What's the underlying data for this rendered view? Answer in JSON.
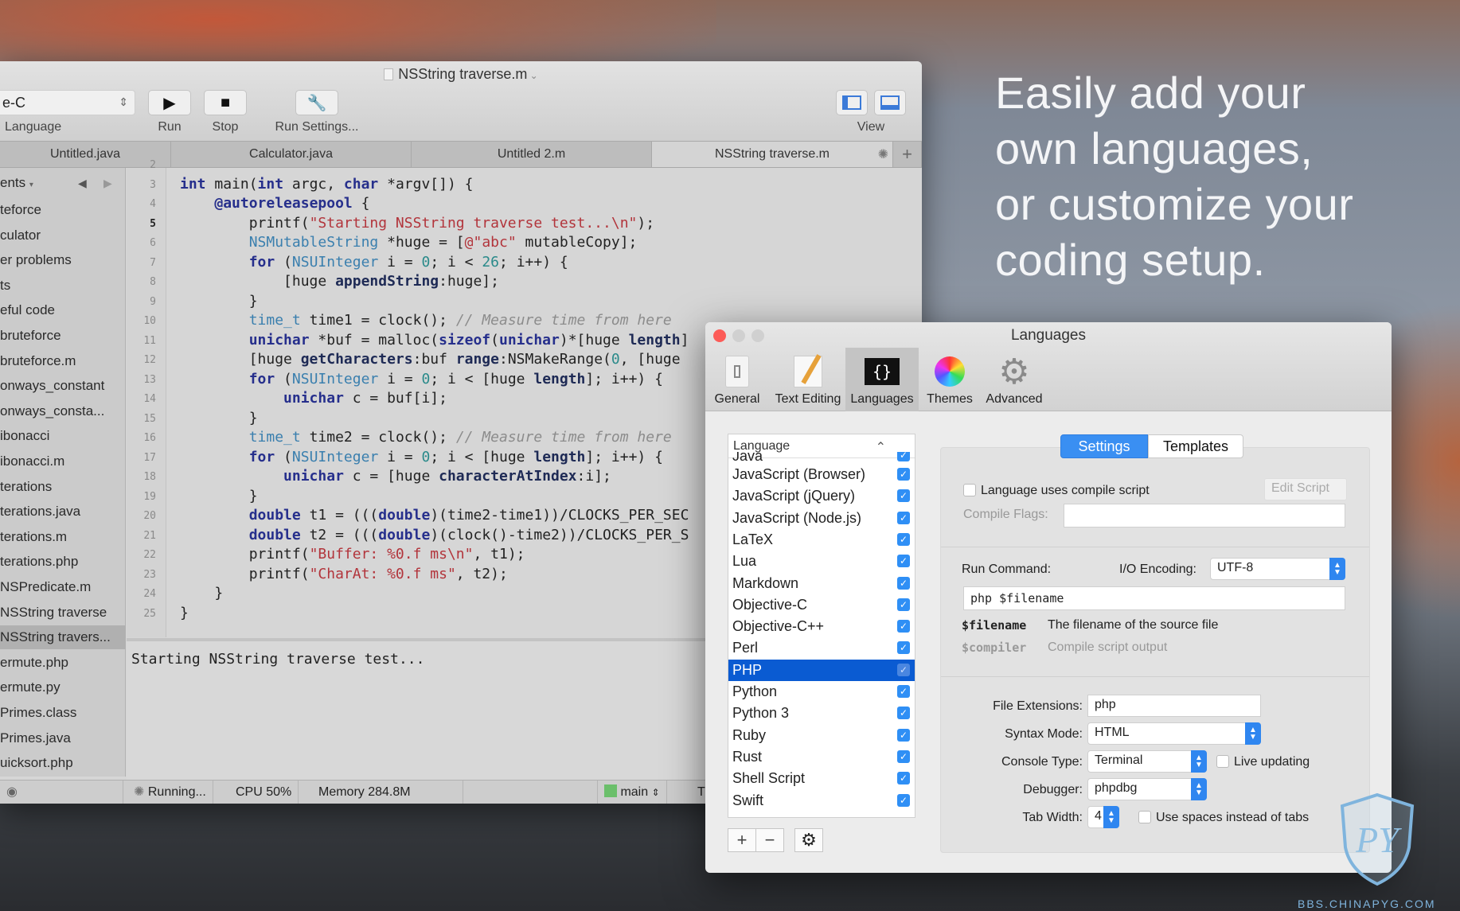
{
  "headline": [
    "Easily add your",
    "own languages,",
    "or customize your",
    "coding setup."
  ],
  "main_window": {
    "title": "NSString traverse.m",
    "toolbar": {
      "language_value": "e-C",
      "language_label": "Language",
      "run_label": "Run",
      "stop_label": "Stop",
      "run_settings_label": "Run Settings...",
      "view_label": "View"
    },
    "tabs": [
      "Untitled.java",
      "Calculator.java",
      "Untitled 2.m",
      "NSString traverse.m"
    ],
    "active_tab": 3,
    "sidebar": {
      "header": "ents",
      "items": [
        "teforce",
        "culator",
        "er problems",
        "ts",
        "eful code",
        "bruteforce",
        "bruteforce.m",
        "onways_constant",
        "onways_consta...",
        "ibonacci",
        "ibonacci.m",
        "terations",
        "terations.java",
        "terations.m",
        "terations.php",
        "NSPredicate.m",
        "NSString traverse",
        "NSString travers...",
        "ermute.php",
        "ermute.py",
        "Primes.class",
        "Primes.java",
        "uicksort.php"
      ],
      "selected": 17
    },
    "current_line": 5,
    "code_lines": [
      {
        "n": "2",
        "t": []
      },
      {
        "n": "3",
        "t": [
          [
            "int",
            "kw"
          ],
          [
            " main("
          ],
          [
            "int",
            "kw"
          ],
          [
            " argc, "
          ],
          [
            "char",
            "kw"
          ],
          [
            " *argv[]) {"
          ]
        ]
      },
      {
        "n": "4",
        "t": [
          [
            "    "
          ],
          [
            "@autoreleasepool",
            "kw"
          ],
          [
            " {"
          ]
        ]
      },
      {
        "n": "5",
        "t": [
          [
            "        printf("
          ],
          [
            "\"Starting NSString traverse test...\\n\"",
            "str"
          ],
          [
            ");"
          ]
        ]
      },
      {
        "n": "6",
        "t": [
          [
            "        "
          ],
          [
            "NSMutableString",
            "ty"
          ],
          [
            " *huge = ["
          ],
          [
            "@\"abc\"",
            "str"
          ],
          [
            " mutableCopy];"
          ]
        ]
      },
      {
        "n": "7",
        "t": [
          [
            "        "
          ],
          [
            "for",
            "kw"
          ],
          [
            " ("
          ],
          [
            "NSUInteger",
            "ty"
          ],
          [
            " i = "
          ],
          [
            "0",
            "num"
          ],
          [
            "; i < "
          ],
          [
            "26",
            "num"
          ],
          [
            "; i++) {"
          ]
        ]
      },
      {
        "n": "8",
        "t": [
          [
            "            [huge "
          ],
          [
            "appendString",
            "mth"
          ],
          [
            ":huge];"
          ]
        ]
      },
      {
        "n": "9",
        "t": [
          [
            "        }"
          ]
        ]
      },
      {
        "n": "10",
        "t": [
          [
            "        "
          ],
          [
            "time_t",
            "ty"
          ],
          [
            " time1 = clock(); "
          ],
          [
            "// Measure time from here",
            "cm"
          ]
        ]
      },
      {
        "n": "11",
        "t": [
          [
            "        "
          ],
          [
            "unichar",
            "kw"
          ],
          [
            " *buf = malloc("
          ],
          [
            "sizeof",
            "kw"
          ],
          [
            "("
          ],
          [
            "unichar",
            "kw"
          ],
          [
            ")*[huge "
          ],
          [
            "length",
            "mth"
          ],
          [
            "]"
          ]
        ]
      },
      {
        "n": "12",
        "t": [
          [
            "        [huge "
          ],
          [
            "getCharacters",
            "mth"
          ],
          [
            ":buf "
          ],
          [
            "range",
            "mth"
          ],
          [
            ":NSMakeRange("
          ],
          [
            "0",
            "num"
          ],
          [
            ", [huge"
          ]
        ]
      },
      {
        "n": "13",
        "t": [
          [
            "        "
          ],
          [
            "for",
            "kw"
          ],
          [
            " ("
          ],
          [
            "NSUInteger",
            "ty"
          ],
          [
            " i = "
          ],
          [
            "0",
            "num"
          ],
          [
            "; i < [huge "
          ],
          [
            "length",
            "mth"
          ],
          [
            "]; i++) {"
          ]
        ]
      },
      {
        "n": "14",
        "t": [
          [
            "            "
          ],
          [
            "unichar",
            "kw"
          ],
          [
            " c = buf[i];"
          ]
        ]
      },
      {
        "n": "15",
        "t": [
          [
            "        }"
          ]
        ]
      },
      {
        "n": "16",
        "t": [
          [
            "        "
          ],
          [
            "time_t",
            "ty"
          ],
          [
            " time2 = clock(); "
          ],
          [
            "// Measure time from here",
            "cm"
          ]
        ]
      },
      {
        "n": "17",
        "t": [
          [
            "        "
          ],
          [
            "for",
            "kw"
          ],
          [
            " ("
          ],
          [
            "NSUInteger",
            "ty"
          ],
          [
            " i = "
          ],
          [
            "0",
            "num"
          ],
          [
            "; i < [huge "
          ],
          [
            "length",
            "mth"
          ],
          [
            "]; i++) {"
          ]
        ]
      },
      {
        "n": "18",
        "t": [
          [
            "            "
          ],
          [
            "unichar",
            "kw"
          ],
          [
            " c = [huge "
          ],
          [
            "characterAtIndex",
            "mth"
          ],
          [
            ":i];"
          ]
        ]
      },
      {
        "n": "19",
        "t": [
          [
            "        }"
          ]
        ]
      },
      {
        "n": "20",
        "t": [
          [
            "        "
          ],
          [
            "double",
            "kw"
          ],
          [
            " t1 = ((("
          ],
          [
            "double",
            "kw"
          ],
          [
            ")(time2-time1))/CLOCKS_PER_SEC"
          ]
        ]
      },
      {
        "n": "21",
        "t": [
          [
            "        "
          ],
          [
            "double",
            "kw"
          ],
          [
            " t2 = ((("
          ],
          [
            "double",
            "kw"
          ],
          [
            ")(clock()-time2))/CLOCKS_PER_S"
          ]
        ]
      },
      {
        "n": "22",
        "t": [
          [
            "        printf("
          ],
          [
            "\"Buffer: %0.f ms\\n\"",
            "str"
          ],
          [
            ", t1);"
          ]
        ]
      },
      {
        "n": "23",
        "t": [
          [
            "        printf("
          ],
          [
            "\"CharAt: %0.f ms\"",
            "str"
          ],
          [
            ", t2);"
          ]
        ]
      },
      {
        "n": "24",
        "t": [
          [
            "    }"
          ]
        ]
      },
      {
        "n": "25",
        "t": [
          [
            "}"
          ]
        ]
      }
    ],
    "console_output": "Starting NSString traverse test...",
    "status": {
      "running": "Running...",
      "cpu": "CPU 50%",
      "memory": "Memory 284.8M",
      "branch": "main",
      "trailing": "T"
    }
  },
  "dialog": {
    "title": "Languages",
    "toolbar": [
      "General",
      "Text Editing",
      "Languages",
      "Themes",
      "Advanced"
    ],
    "active_pane": 2,
    "list_header": "Language",
    "list_partial": "Java",
    "languages": [
      "JavaScript (Browser)",
      "JavaScript (jQuery)",
      "JavaScript (Node.js)",
      "LaTeX",
      "Lua",
      "Markdown",
      "Objective-C",
      "Objective-C++",
      "Perl",
      "PHP",
      "Python",
      "Python 3",
      "Ruby",
      "Rust",
      "Shell Script",
      "Swift"
    ],
    "selected_language": "PHP",
    "tabs": [
      "Settings",
      "Templates"
    ],
    "active_tab": 0,
    "compile_script_label": "Language uses compile script",
    "compile_script_checked": false,
    "edit_script_label": "Edit Script",
    "compile_flags_label": "Compile Flags:",
    "compile_flags_value": "",
    "run_command_label": "Run Command:",
    "io_encoding_label": "I/O Encoding:",
    "io_encoding_value": "UTF-8",
    "run_command_value": "php $filename",
    "vars": [
      {
        "name": "$filename",
        "desc": "The filename of the source file"
      },
      {
        "name": "$compiler",
        "desc": "Compile script output"
      }
    ],
    "file_extensions_label": "File Extensions:",
    "file_extensions_value": "php",
    "syntax_mode_label": "Syntax Mode:",
    "syntax_mode_value": "HTML",
    "console_type_label": "Console Type:",
    "console_type_value": "Terminal",
    "live_updating_label": "Live updating",
    "live_updating_checked": false,
    "debugger_label": "Debugger:",
    "debugger_value": "phpdbg",
    "tab_width_label": "Tab Width:",
    "tab_width_value": "4",
    "use_spaces_label": "Use spaces instead of tabs",
    "use_spaces_checked": false
  },
  "watermark": {
    "text": "BBS.CHINAPYG.COM",
    "logo_letters": "PY"
  },
  "colors": {
    "accent": "#2f86f0",
    "selection": "#0a5bd2",
    "close": "#fc5b57"
  }
}
